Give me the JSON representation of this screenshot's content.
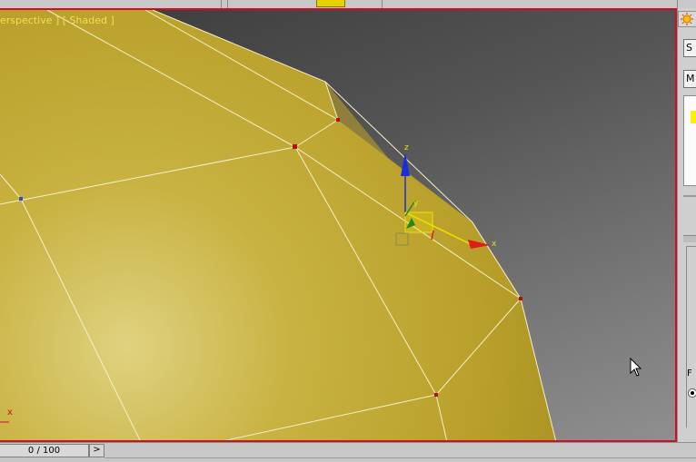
{
  "viewport": {
    "label": "erspective ] [ Shaded ]",
    "axis_labels": {
      "x": "x",
      "y": "y",
      "z": "z"
    },
    "corner_axis_label": "x",
    "object_color": "#c9b23a",
    "border_color": "#d10f24"
  },
  "gizmo": {
    "x_color": "#e01b1b",
    "y_color": "#1f8a1f",
    "z_color": "#1a2fd6",
    "plane_color": "#f0e000"
  },
  "right_panel": {
    "button_s_label": "S",
    "button_m_label": "M",
    "button_f_label": "F"
  },
  "timeline": {
    "frame_label": "0 / 100",
    "next_button_label": ">"
  },
  "icons": [
    "sun-icon",
    "mouse-pointer-icon",
    "move-gizmo-icon"
  ]
}
